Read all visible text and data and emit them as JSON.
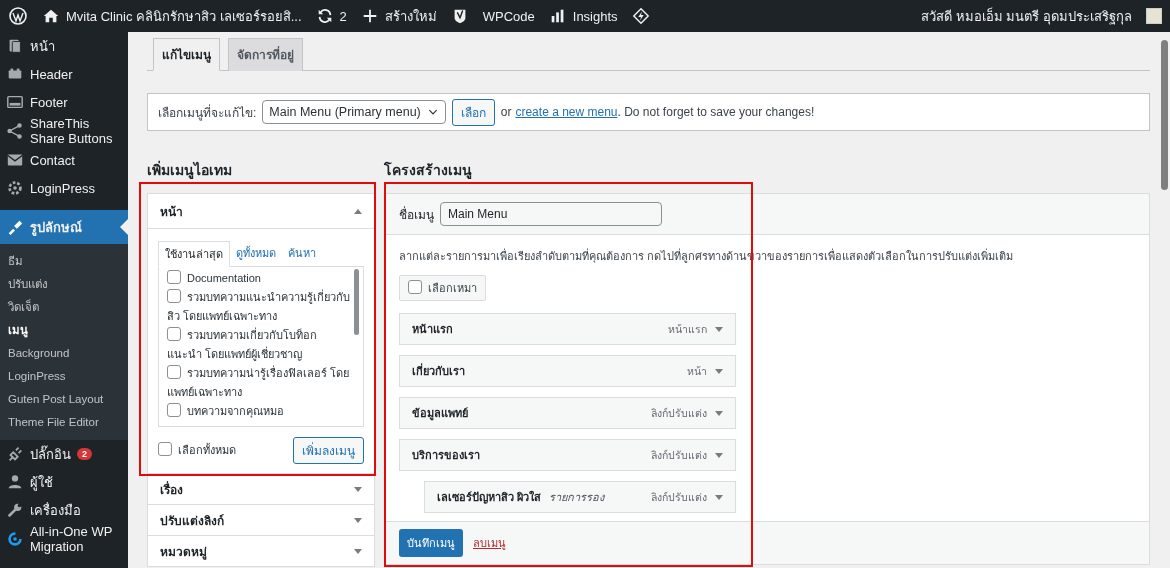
{
  "admin_bar": {
    "site_name": "Mvita Clinic คลินิกรักษาสิว เลเซอร์รอยสิ...",
    "updates_count": "2",
    "new_label": "สร้างใหม่",
    "wpcode": "WPCode",
    "insights": "Insights",
    "greeting": "สวัสดี หมอเอ็ม มนตรี อุดมประเสริฐกุล"
  },
  "sidebar": {
    "items": [
      {
        "label": "หน้า",
        "selected": false
      },
      {
        "label": "Header",
        "selected": false
      },
      {
        "label": "Footer",
        "selected": false
      },
      {
        "label": "ShareThis Share Buttons",
        "selected": false
      },
      {
        "label": "Contact",
        "selected": false
      },
      {
        "label": "LoginPress",
        "selected": false
      },
      {
        "label": "รูปลักษณ์",
        "selected": true,
        "children": [
          {
            "label": "ธีม",
            "selected": false
          },
          {
            "label": "ปรับแต่ง",
            "selected": false
          },
          {
            "label": "วิดเจ็ต",
            "selected": false
          },
          {
            "label": "เมนู",
            "selected": true
          },
          {
            "label": "Background",
            "selected": false
          },
          {
            "label": "LoginPress",
            "selected": false
          },
          {
            "label": "Guten Post Layout",
            "selected": false
          },
          {
            "label": "Theme File Editor",
            "selected": false
          }
        ]
      },
      {
        "label": "ปลั๊กอิน",
        "selected": false,
        "badge": "2"
      },
      {
        "label": "ผู้ใช้",
        "selected": false
      },
      {
        "label": "เครื่องมือ",
        "selected": false
      },
      {
        "label": "All-in-One WP Migration",
        "selected": false
      }
    ]
  },
  "tabs": [
    {
      "label": "แก้ไขเมนู",
      "selected": true
    },
    {
      "label": "จัดการที่อยู่",
      "selected": false
    }
  ],
  "menu_select": {
    "label": "เลือกเมนูที่จะแก้ไข:",
    "value": "Main Menu (Primary menu)",
    "button": "เลือก",
    "or_text": "or",
    "link": "create a new menu",
    "note": ". Do not forget to save your changes!"
  },
  "add_items": {
    "heading": "เพิ่มเมนูไอเทม",
    "highlighted": true,
    "sections": [
      {
        "title": "หน้า",
        "expanded": true,
        "subtabs": [
          {
            "label": "ใช้งานล่าสุด",
            "selected": true
          },
          {
            "label": "ดูทั้งหมด",
            "selected": false
          },
          {
            "label": "ค้นหา",
            "selected": false
          }
        ],
        "items": [
          {
            "label": "Documentation",
            "checked": false
          },
          {
            "label": "รวมบทความแนะนำความรู้เกี่ยวกับสิว โดยแพทย์เฉพาะทาง",
            "checked": false
          },
          {
            "label": "รวมบทความเกี่ยวกับโบท็อก แนะนำ โดยแพทย์ผู้เชี่ยวชาญ",
            "checked": false
          },
          {
            "label": "รวมบทความน่ารู้เรื่องฟิลเลอร์ โดย แพทย์เฉพาะทาง",
            "checked": false
          },
          {
            "label": "บทความจากคุณหมอ",
            "checked": false
          }
        ],
        "select_all": {
          "label": "เลือกทั้งหมด",
          "checked": false
        },
        "add_button": "เพิ่มลงเมนู"
      },
      {
        "title": "เรื่อง",
        "expanded": false
      },
      {
        "title": "ปรับแต่งลิงก์",
        "expanded": false
      },
      {
        "title": "หมวดหมู่",
        "expanded": false
      }
    ]
  },
  "structure": {
    "heading": "โครงสร้างเมนู",
    "highlighted": true,
    "name_label": "ชื่อเมนู",
    "name_value": "Main Menu",
    "instructions": "ลากแต่ละรายการมาเพื่อเรียงลำดับตามที่คุณต้องการ กดไปที่ลูกศรทางด้านขวาของรายการเพื่อแสดงตัวเลือกในการปรับแต่งเพิ่มเติม",
    "bulk_select": {
      "label": "เลือกเหมา",
      "checked": false
    },
    "items": [
      {
        "title": "หน้าแรก",
        "type": "หน้าแรก"
      },
      {
        "title": "เกี่ยวกับเรา",
        "type": "หน้า"
      },
      {
        "title": "ข้อมูลแพทย์",
        "type": "ลิงก์ปรับแต่ง"
      },
      {
        "title": "บริการของเรา",
        "type": "ลิงก์ปรับแต่ง",
        "children": [
          {
            "title": "เลเซอร์ปัญหาสิว ผิวใส",
            "sub_label": "รายการรอง",
            "type": "ลิงก์ปรับแต่ง"
          }
        ]
      }
    ],
    "save_button": "บันทึกเมนู",
    "delete_link": "ลบเมนู"
  }
}
